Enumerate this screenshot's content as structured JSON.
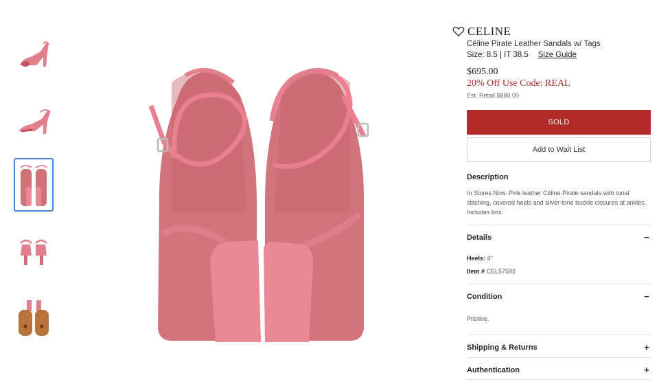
{
  "thumbnails": [
    {
      "name": "thumb-side-view-1",
      "active": false
    },
    {
      "name": "thumb-side-view-2",
      "active": false
    },
    {
      "name": "thumb-top-view",
      "active": true
    },
    {
      "name": "thumb-back-view",
      "active": false
    },
    {
      "name": "thumb-sole-view",
      "active": false
    }
  ],
  "product": {
    "brand": "CELINE",
    "title": "Céline Pirate Leather Sandals w/ Tags",
    "size": "Size: 8.5 | IT 38.5",
    "size_guide": "Size Guide",
    "price": "$695.00",
    "promo": "20% Off Use Code: REAL",
    "est_retail": "Est. Retail $880.00",
    "sold_label": "SOLD",
    "wait_list_label": "Add to Wait List"
  },
  "description": {
    "title": "Description",
    "text": "In Stores Now. Pink leather Céline Pirate sandals with tonal stitching, covered heels and silver-tone buckle closures at ankles. Includes box."
  },
  "details": {
    "title": "Details",
    "toggle": "−",
    "heels_label": "Heels:",
    "heels_value": " 4\"",
    "item_label": "Item #",
    "item_value": " CEL57592"
  },
  "condition": {
    "title": "Condition",
    "toggle": "−",
    "text": "Pristine."
  },
  "shipping": {
    "title": "Shipping & Returns",
    "toggle": "+"
  },
  "authentication": {
    "title": "Authentication",
    "toggle": "+"
  },
  "colors": {
    "sold_red": "#b22a2a",
    "promo_red": "#b32b2b",
    "sandal_pink": "#e7808f",
    "suede_pink": "#d1747b",
    "thumb_active_border": "#4a7fd4"
  }
}
